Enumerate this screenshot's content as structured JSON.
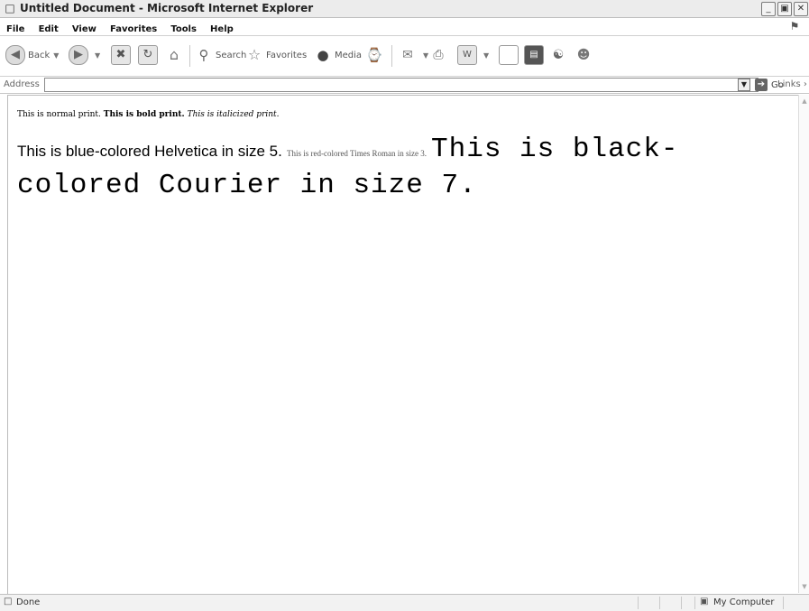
{
  "window": {
    "title": "Untitled Document - Microsoft Internet Explorer",
    "app_icon": "ie-page-icon",
    "controls": [
      "minimize-icon",
      "maximize-icon",
      "close-icon"
    ]
  },
  "menu": {
    "items": [
      "File",
      "Edit",
      "View",
      "Favorites",
      "Tools",
      "Help"
    ]
  },
  "toolbar": {
    "back_label": "Back",
    "search_label": "Search",
    "favorites_label": "Favorites",
    "media_label": "Media"
  },
  "address": {
    "label": "Address",
    "value": "",
    "go_label": "Go",
    "links_label": "Links"
  },
  "page": {
    "line1_normal": "This is normal print.",
    "line1_bold": "This is bold print.",
    "line1_italic": "This is italicized print.",
    "helvetica_text": "This is blue-colored Helvetica in size 5.",
    "times_text": "This is red-colored Times Roman in size 3.",
    "courier_text": "This is black-colored Courier in size 7."
  },
  "status": {
    "text": "Done",
    "zone": "My Computer"
  }
}
